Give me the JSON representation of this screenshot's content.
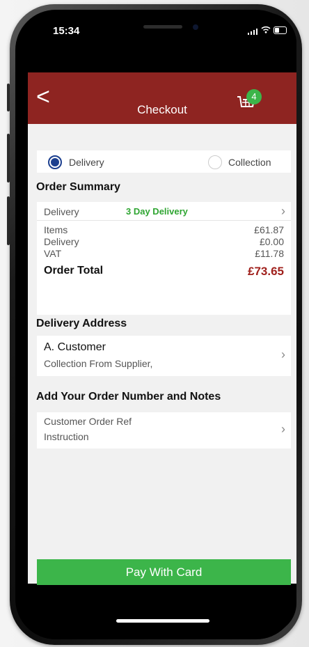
{
  "status": {
    "time": "15:34"
  },
  "header": {
    "back_label": "<",
    "title": "Checkout",
    "cart_count": "4"
  },
  "mode": {
    "delivery_label": "Delivery",
    "collection_label": "Collection",
    "selected": "Delivery"
  },
  "summary": {
    "heading": "Order Summary",
    "delivery_label": "Delivery",
    "delivery_option": "3 Day Delivery",
    "lines": [
      {
        "label": "Items",
        "value": "£61.87"
      },
      {
        "label": "Delivery",
        "value": "£0.00"
      },
      {
        "label": "VAT",
        "value": "£11.78"
      }
    ],
    "total_label": "Order Total",
    "total_value": "£73.65"
  },
  "address": {
    "heading": "Delivery Address",
    "name": "A. Customer",
    "line": "Collection From Supplier,"
  },
  "notes": {
    "heading": "Add Your Order Number and Notes",
    "ref_label": "Customer Order Ref",
    "instruction_label": "Instruction"
  },
  "footer": {
    "pay_label": "Pay With Card"
  },
  "colors": {
    "header": "#8e2421",
    "accent_green": "#3cb54a",
    "total_red": "#a0211d",
    "radio_blue": "#1c3f8f"
  }
}
